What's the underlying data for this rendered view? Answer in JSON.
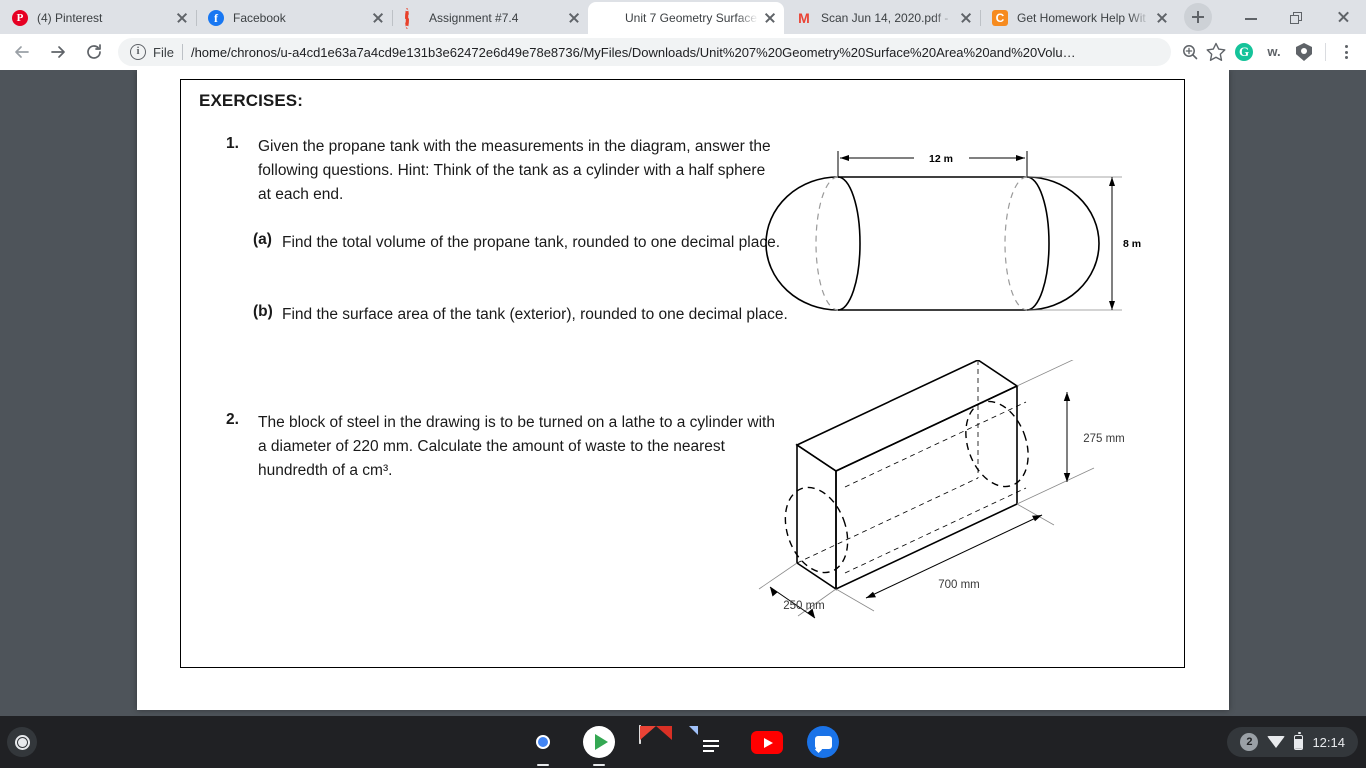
{
  "browser": {
    "tabs": [
      {
        "title": "(4) Pinterest",
        "favicon": "pinterest-icon",
        "active": false
      },
      {
        "title": "Facebook",
        "favicon": "facebook-icon",
        "active": false
      },
      {
        "title": "Assignment #7.4",
        "favicon": "loading-spinner-icon",
        "active": false
      },
      {
        "title": "Unit 7 Geometry Surface",
        "favicon": "globe-icon",
        "active": true
      },
      {
        "title": "Scan Jun 14, 2020.pdf -",
        "favicon": "gmail-icon",
        "active": false
      },
      {
        "title": "Get Homework Help Wit",
        "favicon": "chegg-icon",
        "active": false
      }
    ],
    "new_tab_label": "+",
    "window_controls": {
      "minimize": "minimize-icon",
      "maximize": "maximize-icon",
      "close": "close-icon"
    },
    "toolbar": {
      "back": "back-arrow-icon",
      "forward": "forward-arrow-icon",
      "reload": "reload-icon",
      "security_icon": "info-circle-icon",
      "scheme_label": "File",
      "url": "/home/chronos/u-a4cd1e63a7a4cd9e131b3e62472e6d49e78e8736/MyFiles/Downloads/Unit%207%20Geometry%20Surface%20Area%20and%20Volu…",
      "zoom_icon": "zoom-magnifier-icon",
      "bookmark_icon": "star-icon",
      "extensions": [
        {
          "name": "grammarly-extension-icon",
          "label": "G"
        },
        {
          "name": "wordtune-extension-icon",
          "label": "w."
        },
        {
          "name": "shield-extension-icon",
          "label": ""
        }
      ],
      "menu_icon": "three-dot-menu-icon"
    }
  },
  "document": {
    "heading": "EXERCISES:",
    "questions": [
      {
        "number": "1.",
        "text": "Given the propane tank with the measurements in the diagram, answer the following questions. Hint: Think of the tank as a cylinder with a half sphere at each end.",
        "subquestions": [
          {
            "label": "(a)",
            "text": "Find the total volume of the propane tank, rounded to one decimal place."
          },
          {
            "label": "(b)",
            "text": "Find the surface area of the tank (exterior), rounded to one decimal place."
          }
        ],
        "figure": {
          "name": "propane-tank-diagram",
          "labels": {
            "length": "12 m",
            "diameter": "8 m"
          }
        }
      },
      {
        "number": "2.",
        "text": "The block of steel in the drawing is to be turned on a lathe to a cylinder with a diameter of 220 mm. Calculate the amount of waste to the nearest hundredth of a cm³.",
        "subquestions": [],
        "figure": {
          "name": "steel-block-diagram",
          "labels": {
            "height": "275 mm",
            "length": "700 mm",
            "width": "250 mm"
          }
        }
      }
    ]
  },
  "shelf": {
    "launcher": "launcher-icon",
    "apps": [
      {
        "name": "chrome-app-icon",
        "running": true
      },
      {
        "name": "play-store-app-icon",
        "running": true
      },
      {
        "name": "gmail-app-icon",
        "running": false
      },
      {
        "name": "google-docs-app-icon",
        "running": false
      },
      {
        "name": "youtube-app-icon",
        "running": false
      },
      {
        "name": "messages-app-icon",
        "running": false
      }
    ],
    "tray": {
      "notification_count": "2",
      "wifi": "wifi-icon",
      "battery": "battery-icon",
      "time": "12:14"
    }
  },
  "colors": {
    "tabstrip_bg": "#dee1e6",
    "toolbar_bg": "#ffffff",
    "viewport_bg": "#4e545a",
    "page_bg": "#ffffff",
    "shelf_bg": "#202124",
    "text": "#1a1a1a"
  }
}
